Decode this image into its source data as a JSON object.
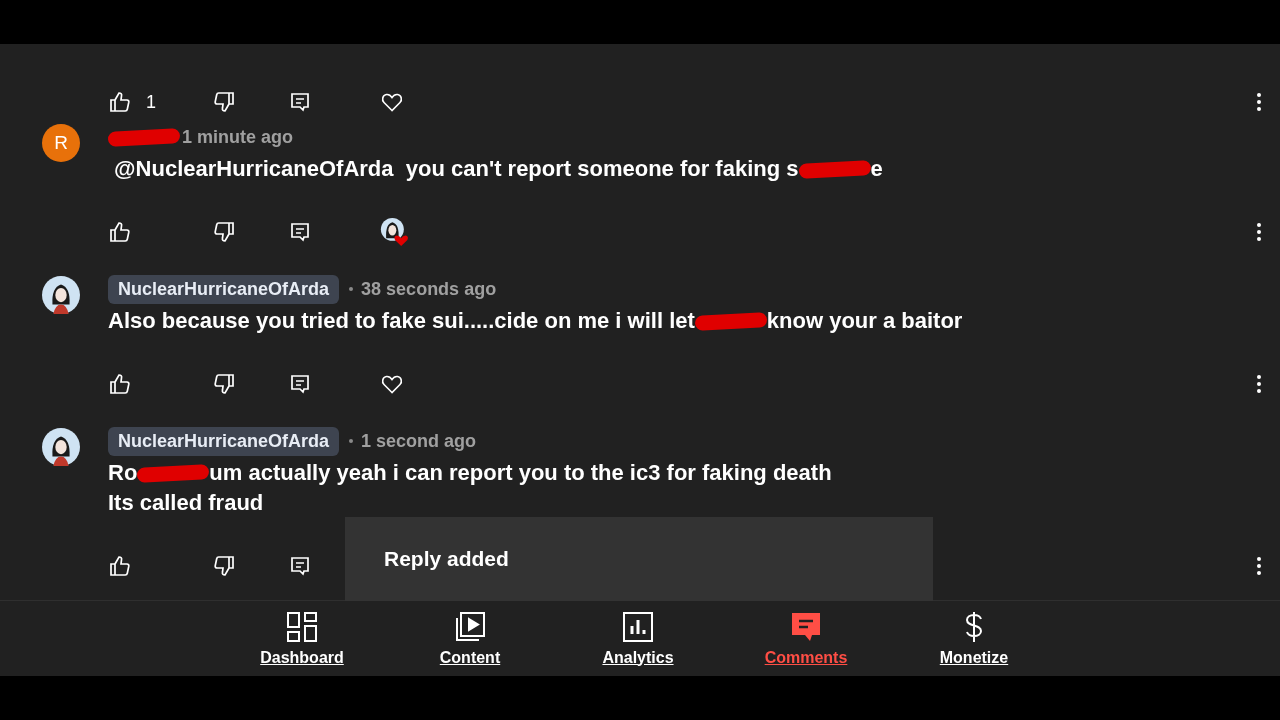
{
  "comments": [
    {
      "kind": "actions_only",
      "actions": {
        "like_count": "1",
        "hearted": false
      }
    },
    {
      "kind": "comment",
      "avatar": {
        "kind": "letter",
        "letter": "R",
        "color": "#e8710a"
      },
      "author": {
        "kind": "redacted"
      },
      "time": "1 minute ago",
      "lines": [
        [
          {
            "kind": "text",
            "text": " @NuclearHurricaneOfArda  you can't report someone for faking s"
          },
          {
            "kind": "redacted"
          },
          {
            "kind": "text",
            "text": "e"
          }
        ]
      ],
      "actions": {
        "hearted": true
      }
    },
    {
      "kind": "comment",
      "avatar": {
        "kind": "figure"
      },
      "author": {
        "kind": "chip",
        "name": "NuclearHurricaneOfArda"
      },
      "time": "38 seconds ago",
      "lines": [
        [
          {
            "kind": "text",
            "text": "Also because you tried to fake sui.....cide on me i will let"
          },
          {
            "kind": "redacted"
          },
          {
            "kind": "text",
            "text": "know your a baitor"
          }
        ]
      ],
      "actions": {
        "hearted": false
      }
    },
    {
      "kind": "comment",
      "avatar": {
        "kind": "figure"
      },
      "author": {
        "kind": "chip",
        "name": "NuclearHurricaneOfArda"
      },
      "time": "1 second ago",
      "lines": [
        [
          {
            "kind": "text",
            "text": "Ro"
          },
          {
            "kind": "redacted"
          },
          {
            "kind": "text",
            "text": "um actually yeah i can report you to the ic3 for faking death"
          }
        ],
        [
          {
            "kind": "text",
            "text": "Its called fraud"
          }
        ]
      ]
    }
  ],
  "snackbar": {
    "text": "Reply added"
  },
  "nav": [
    {
      "label": "Dashboard",
      "selected": false
    },
    {
      "label": "Content",
      "selected": false
    },
    {
      "label": "Analytics",
      "selected": false
    },
    {
      "label": "Comments",
      "selected": true
    },
    {
      "label": "Monetize",
      "selected": false
    }
  ]
}
